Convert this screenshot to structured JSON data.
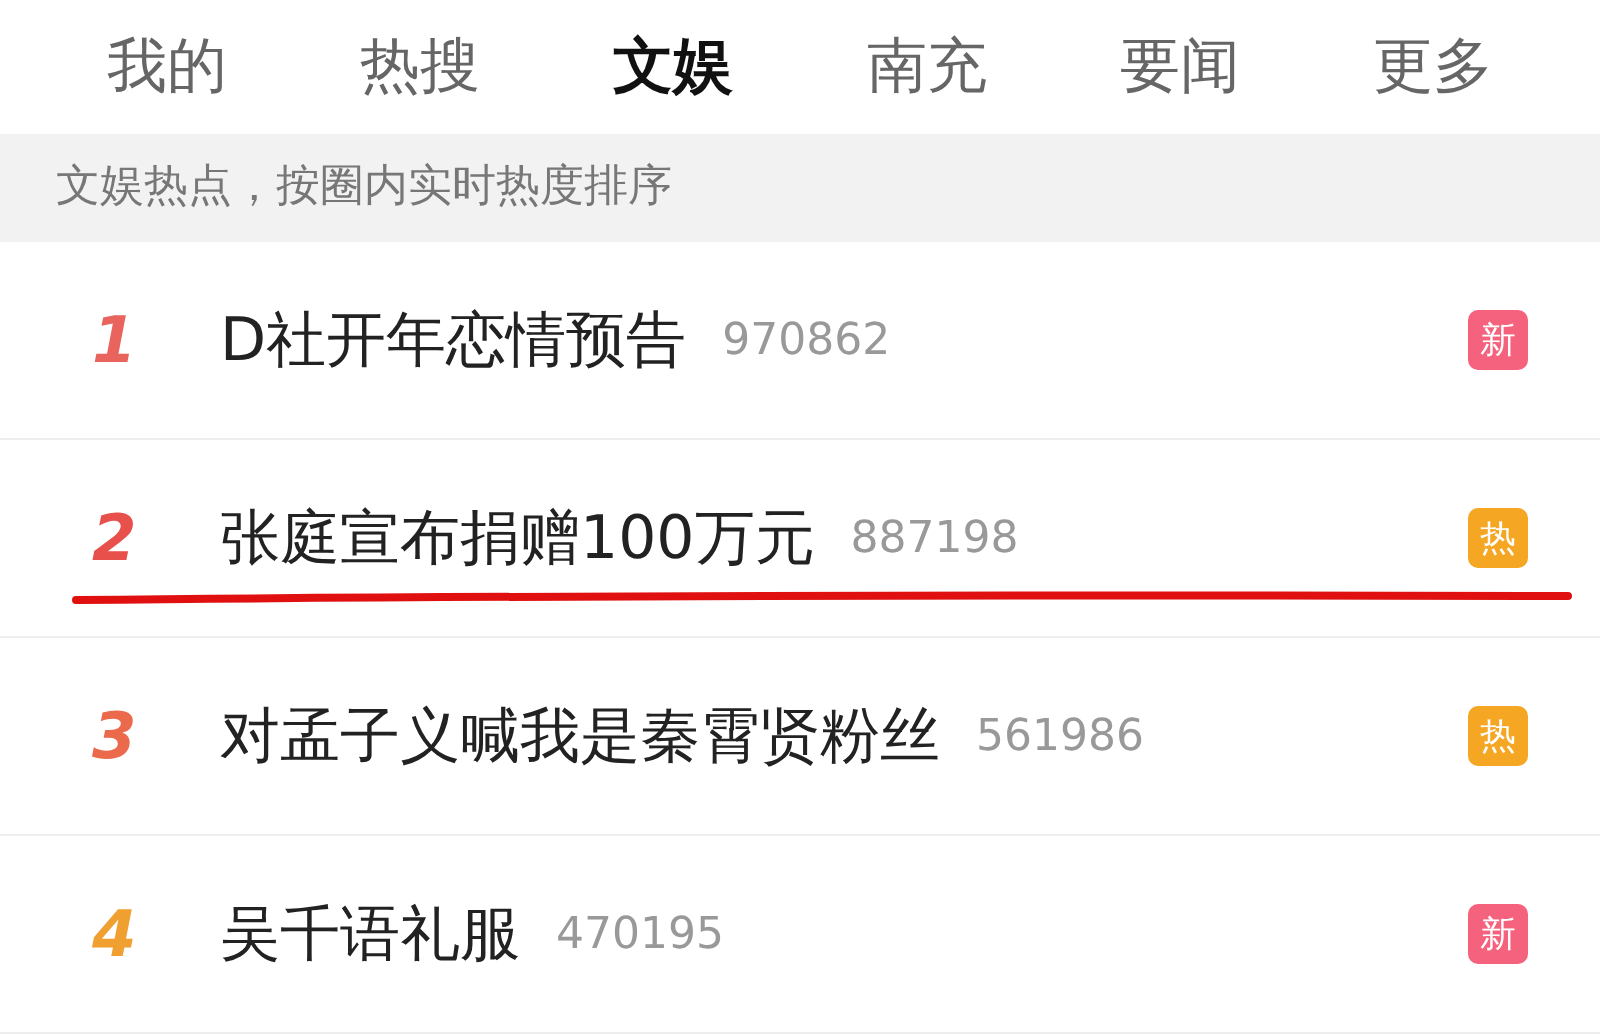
{
  "tabs": [
    {
      "label": "我的",
      "selected": false
    },
    {
      "label": "热搜",
      "selected": false
    },
    {
      "label": "文娱",
      "selected": true
    },
    {
      "label": "南充",
      "selected": false
    },
    {
      "label": "要闻",
      "selected": false
    },
    {
      "label": "更多",
      "selected": false
    }
  ],
  "subheader": "文娱热点，按圈内实时热度排序",
  "items": [
    {
      "rank": "1",
      "color": "#e8645c",
      "title": "D社开年恋情预告",
      "count": "970862",
      "badge": {
        "kind": "new",
        "text": "新"
      },
      "underlined": false
    },
    {
      "rank": "2",
      "color": "#e8504c",
      "title": "张庭宣布捐赠100万元",
      "count": "887198",
      "badge": {
        "kind": "hot",
        "text": "热"
      },
      "underlined": true
    },
    {
      "rank": "3",
      "color": "#ec6a4c",
      "title": "对孟子义喊我是秦霄贤粉丝",
      "count": "561986",
      "badge": {
        "kind": "hot",
        "text": "热"
      },
      "underlined": false
    },
    {
      "rank": "4",
      "color": "#f0a030",
      "title": "吴千语礼服",
      "count": "470195",
      "badge": {
        "kind": "new",
        "text": "新"
      },
      "underlined": false
    }
  ]
}
